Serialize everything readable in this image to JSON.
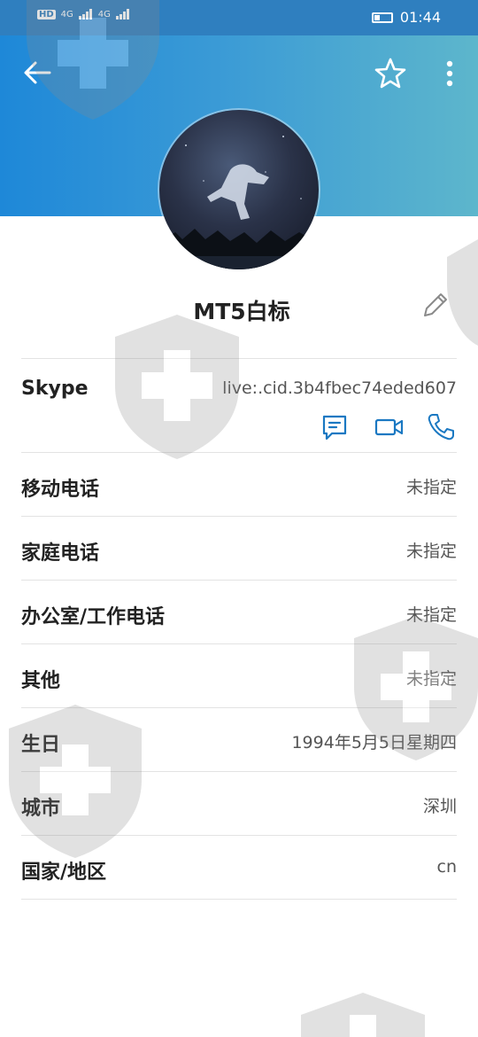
{
  "status_bar": {
    "left_icons": [
      "HD",
      "4G",
      "4G"
    ],
    "time": "01:44",
    "battery_icon": "battery-icon"
  },
  "toolbar": {
    "back_icon": "back-arrow-icon",
    "favorite_icon": "star-icon",
    "more_icon": "more-vertical-icon"
  },
  "colors": {
    "header_start": "#1e88d8",
    "header_end": "#5db6cc",
    "accent": "#1a78c2"
  },
  "profile": {
    "name": "MT5白标",
    "edit_icon": "pencil-icon"
  },
  "skype": {
    "label": "Skype",
    "value": "live:.cid.3b4fbec74eded607",
    "actions": [
      "message-icon",
      "video-call-icon",
      "phone-icon"
    ]
  },
  "fields": [
    {
      "label": "移动电话",
      "value": "未指定"
    },
    {
      "label": "家庭电话",
      "value": "未指定"
    },
    {
      "label": "办公室/工作电话",
      "value": "未指定"
    },
    {
      "label": "其他",
      "value": "未指定"
    },
    {
      "label": "生日",
      "value": "1994年5月5日星期四"
    },
    {
      "label": "城市",
      "value": "深圳"
    },
    {
      "label": "国家/地区",
      "value": "cn"
    }
  ]
}
